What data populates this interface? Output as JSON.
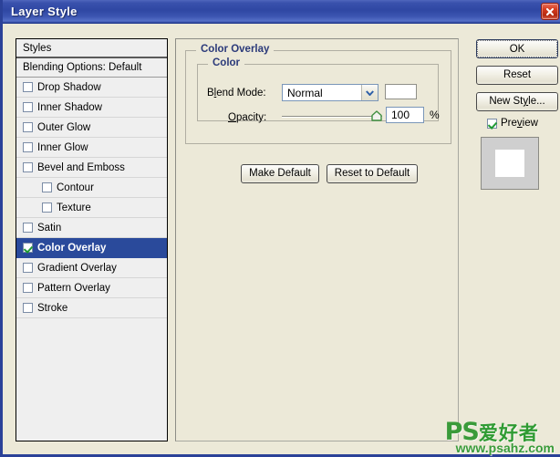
{
  "window": {
    "title": "Layer Style",
    "close_icon": "close-x-icon",
    "accent_titlebar": "#2f47a3",
    "close_button_color": "#d43a1e"
  },
  "styles_list": {
    "header": "Styles",
    "blending_options": "Blending Options: Default",
    "items": [
      {
        "label": "Drop Shadow",
        "checked": false,
        "indent": false,
        "selected": false
      },
      {
        "label": "Inner Shadow",
        "checked": false,
        "indent": false,
        "selected": false
      },
      {
        "label": "Outer Glow",
        "checked": false,
        "indent": false,
        "selected": false
      },
      {
        "label": "Inner Glow",
        "checked": false,
        "indent": false,
        "selected": false
      },
      {
        "label": "Bevel and Emboss",
        "checked": false,
        "indent": false,
        "selected": false
      },
      {
        "label": "Contour",
        "checked": false,
        "indent": true,
        "selected": false
      },
      {
        "label": "Texture",
        "checked": false,
        "indent": true,
        "selected": false
      },
      {
        "label": "Satin",
        "checked": false,
        "indent": false,
        "selected": false
      },
      {
        "label": "Color Overlay",
        "checked": true,
        "indent": false,
        "selected": true
      },
      {
        "label": "Gradient Overlay",
        "checked": false,
        "indent": false,
        "selected": false
      },
      {
        "label": "Pattern Overlay",
        "checked": false,
        "indent": false,
        "selected": false
      },
      {
        "label": "Stroke",
        "checked": false,
        "indent": false,
        "selected": false
      }
    ],
    "selection_color": "#2a4a9b",
    "checkmark_color": "#1f9a33"
  },
  "options_panel": {
    "group_title": "Color Overlay",
    "color_group_title": "Color",
    "group_title_color": "#2b3a7a",
    "blend_mode": {
      "label_pre": "B",
      "label_accesskey": "l",
      "label_post": "end Mode:",
      "label_full": "Blend Mode:",
      "value": "Normal",
      "arrow_icon": "chevron-down-icon",
      "arrow_color": "#2d5fa8"
    },
    "color_swatch": {
      "value": "#ffffff"
    },
    "opacity": {
      "label_pre": "",
      "label_accesskey": "O",
      "label_post": "pacity:",
      "label_full": "Opacity:",
      "value": "100",
      "unit": "%",
      "slider_position_percent": 100,
      "thumb_color": "#3f8f3f"
    },
    "buttons": {
      "make_default": "Make Default",
      "reset_to_default": "Reset to Default"
    }
  },
  "side_buttons": {
    "ok": "OK",
    "reset": "Reset",
    "new_style_pre": "New St",
    "new_style_accesskey": "y",
    "new_style_post": "le...",
    "new_style_full": "New Style...",
    "preview_pre": "Pre",
    "preview_accesskey": "v",
    "preview_post": "iew",
    "preview_full": "Preview",
    "preview_checked": true
  },
  "watermark": {
    "brand": "PS",
    "brand_cn": "爱好者",
    "url": "www.psahz.com",
    "color": "#3a9b3a"
  }
}
